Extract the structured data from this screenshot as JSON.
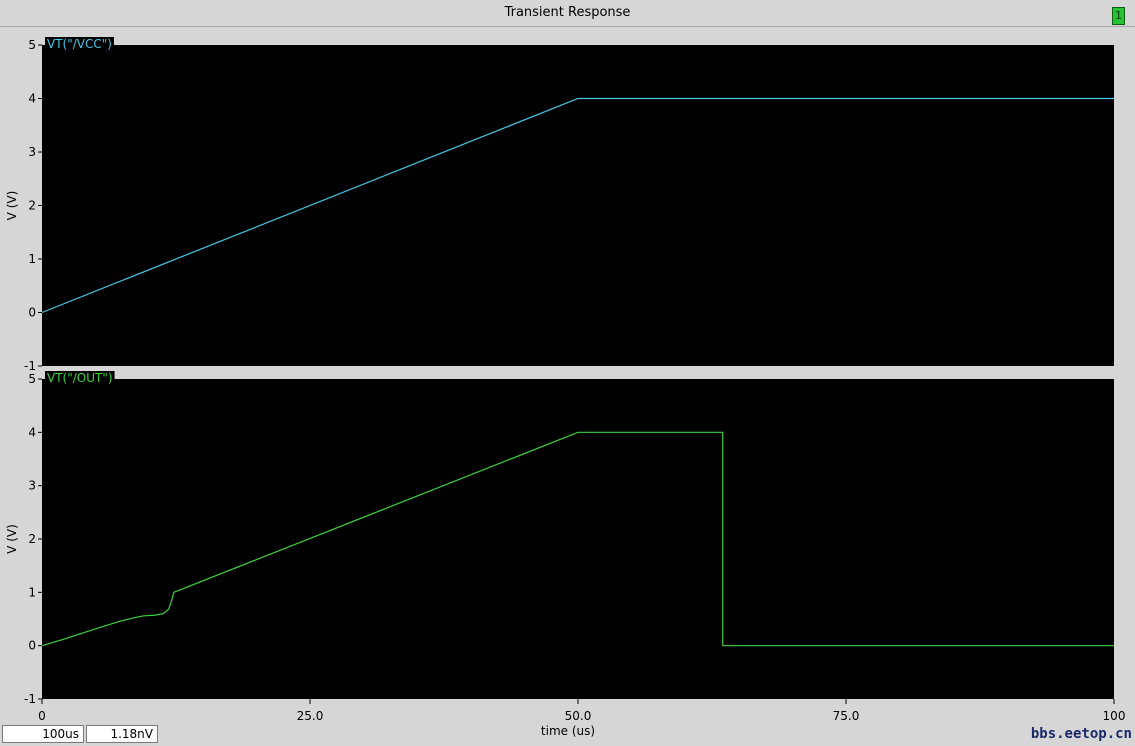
{
  "window": {
    "title": "Transient Response",
    "badge": "1"
  },
  "status": {
    "time": "100us",
    "value": "1.18nV"
  },
  "watermark": "bbs.eetop.cn",
  "colors": {
    "background": "#000000",
    "frame": "#d6d6d6",
    "vcc_trace": "#46c8e8",
    "out_trace": "#3cd23c"
  },
  "chart_data": {
    "type": "line",
    "xlabel": "time (us)",
    "xlim": [
      0,
      100
    ],
    "x_ticks": [
      0,
      25,
      50,
      75,
      100
    ],
    "x_tick_labels": [
      "0",
      "25.0",
      "50.0",
      "75.0",
      "100"
    ],
    "panels": [
      {
        "series_name": "VT(\"/VCC\")",
        "ylabel": "V (V)",
        "ylim": [
          -1,
          5
        ],
        "y_ticks": [
          -1,
          0,
          1,
          2,
          3,
          4,
          5
        ],
        "y_tick_labels": [
          "-1",
          "0",
          "1",
          "2",
          "3",
          "4",
          "5"
        ],
        "color": "#46c8e8",
        "points": [
          [
            0,
            0
          ],
          [
            50,
            4
          ],
          [
            100,
            4
          ]
        ]
      },
      {
        "series_name": "VT(\"/OUT\")",
        "ylabel": "V (V)",
        "ylim": [
          -1,
          5
        ],
        "y_ticks": [
          -1,
          0,
          1,
          2,
          3,
          4,
          5
        ],
        "y_tick_labels": [
          "-1",
          "0",
          "1",
          "2",
          "3",
          "4",
          "5"
        ],
        "color": "#3cd23c",
        "points": [
          [
            0,
            0
          ],
          [
            2,
            0.12
          ],
          [
            4,
            0.25
          ],
          [
            6,
            0.38
          ],
          [
            7.5,
            0.47
          ],
          [
            8.5,
            0.52
          ],
          [
            9.5,
            0.56
          ],
          [
            10.5,
            0.57
          ],
          [
            11.3,
            0.6
          ],
          [
            11.8,
            0.68
          ],
          [
            12.1,
            0.85
          ],
          [
            12.3,
            1.0
          ],
          [
            50,
            4
          ],
          [
            63.5,
            4
          ],
          [
            63.5,
            0
          ],
          [
            100,
            0
          ]
        ]
      }
    ]
  }
}
